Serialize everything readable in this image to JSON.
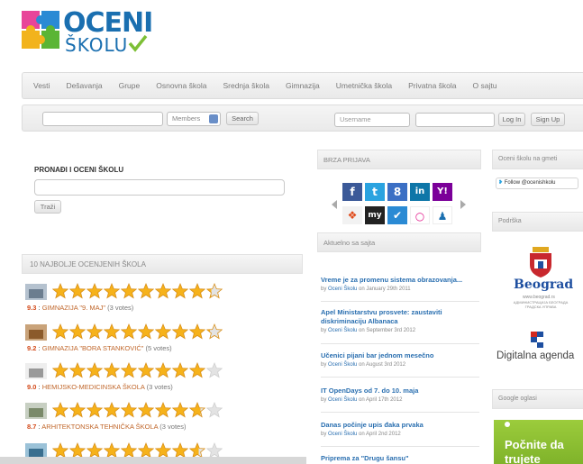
{
  "logo": {
    "top": "OCENI",
    "bottom": "ŠKOLU"
  },
  "nav": {
    "items": [
      "Vesti",
      "Dešavanja",
      "Grupe",
      "Osnovna škola",
      "Srednja škola",
      "Gimnazija",
      "Umetnička škola",
      "Privatna škola",
      "O sajtu"
    ]
  },
  "searchbar": {
    "members_label": "Members",
    "search_button": "Search",
    "username_placeholder": "Username",
    "login_button": "Log In",
    "signup_button": "Sign Up"
  },
  "rate_box": {
    "title": "PRONAĐI I OCENI ŠKOLU",
    "search_button": "Traži"
  },
  "top_schools": {
    "title": "10 NAJBOLJE OCENJENIH ŠKOLA",
    "items": [
      {
        "score": "9.3",
        "name": "GIMNAZIJA \"9. MAJ\"",
        "votes": "(3 votes)",
        "stars_filled": 9.3
      },
      {
        "score": "9.2",
        "name": "GIMNAZIJA \"BORA STANKOVIĆ\"",
        "votes": "(5 votes)",
        "stars_filled": 9.2
      },
      {
        "score": "9.0",
        "name": "HEMIJSKO-MEDICINSKA ŠKOLA",
        "votes": "(3 votes)",
        "stars_filled": 9.0
      },
      {
        "score": "8.7",
        "name": "ARHITEKTONSKA TEHNIČKA ŠKOLA",
        "votes": "(3 votes)",
        "stars_filled": 8.7
      },
      {
        "score": "",
        "name": "",
        "votes": "",
        "stars_filled": 8.6
      }
    ]
  },
  "quick_login": {
    "title": "BRZA PRIJAVA"
  },
  "news": {
    "title": "Aktuelno sa sajta",
    "items": [
      {
        "title": "Vreme je za promenu sistema obrazovanja...",
        "by": "by",
        "author": "Oceni Školu",
        "date": "on January 29th 2011"
      },
      {
        "title": "Apel Ministarstvu prosvete: zaustaviti diskriminaciju Albanaca",
        "by": "by",
        "author": "Oceni Školu",
        "date": "on September 3rd 2012"
      },
      {
        "title": "Učenici pijani bar jednom mesečno",
        "by": "by",
        "author": "Oceni Školu",
        "date": "on August 3rd 2012"
      },
      {
        "title": "IT OpenDays od 7. do 10. maja",
        "by": "by",
        "author": "Oceni Školu",
        "date": "on April 17th 2012"
      },
      {
        "title": "Danas počinje upis đaka prvaka",
        "by": "by",
        "author": "Oceni Školu",
        "date": "on April 2nd 2012"
      },
      {
        "title": "Priprema za \"Drugu šansu\"",
        "by": "",
        "author": "",
        "date": ""
      }
    ]
  },
  "right": {
    "twitter_head": "Oceni školu na gmeti",
    "follow_label": "Follow @ocenishkolu",
    "support_head": "Podrška",
    "beograd_name": "Beograd",
    "beograd_web": "www.beograd.rs",
    "beograd_sub": "АДМИНИСТРАЦИЈА БЕОГРАДА ГРАДСКА УПРАВА",
    "digital_agenda": "Digitalna agenda",
    "ads_head": "Google oglasi",
    "ad_line1": "Počnite da",
    "ad_line2": "trujete"
  },
  "colors": {
    "brand": "#1a6fb0",
    "accent_green": "#8bc34a",
    "score": "#d34a1a",
    "link": "#2a6fb0"
  }
}
